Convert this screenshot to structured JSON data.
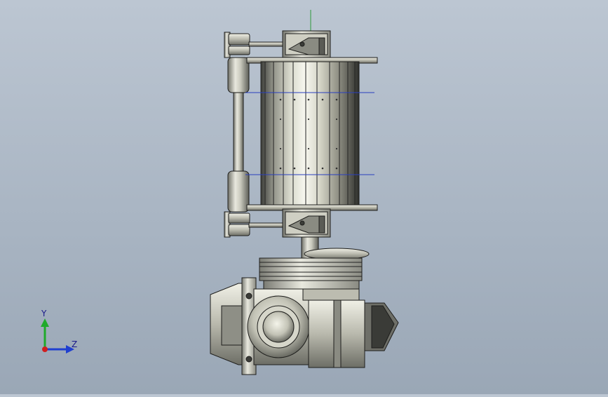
{
  "viewport": {
    "background_top": "#bcc6d2",
    "background_bottom": "#9aa7b6",
    "model": "mechanical-assembly-drum-with-gearbox"
  },
  "triad": {
    "y_label": "Y",
    "z_label": "Z",
    "y_color": "#1faa2a",
    "z_color": "#1f3fd0",
    "x_color": "#d01f1f"
  }
}
